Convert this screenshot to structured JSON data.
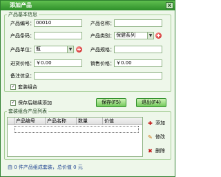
{
  "window": {
    "title": "添加产品",
    "close_label": "x"
  },
  "product_info": {
    "group_title": "产品基本信息",
    "code_label": "产品编号：",
    "code_value": "00010",
    "name_label": "产品名称：",
    "name_value": "",
    "barcode_label": "产品条码：",
    "barcode_value": "",
    "category_label": "产品类别：",
    "category_value": "保健系列",
    "unit_label": "产品单位：",
    "unit_value": "瓶",
    "spec_label": "产品规格：",
    "spec_value": "",
    "purchase_price_label": "进货价格：",
    "purchase_price_value": "￥0.00",
    "sale_price_label": "销售价格：",
    "sale_price_value": "￥0.00",
    "remark_label": "备注信息：",
    "remark_value": "",
    "package_combo_label": "套装组合",
    "package_combo_checked": true
  },
  "continue_after_save": {
    "label": "保存后继续添加",
    "checked": true
  },
  "buttons": {
    "save_label": "保存(F5)",
    "exit_label": "退出(F4)"
  },
  "package_list": {
    "group_title": "套装组合产品列表",
    "columns": [
      "产品编号",
      "产品名称",
      "数量",
      "价值"
    ],
    "rows": []
  },
  "actions": {
    "add_label": "添加",
    "edit_label": "修改",
    "delete_label": "删除"
  },
  "status": {
    "text": "由 0 件产品组成套装，总价值 0 元"
  },
  "colors": {
    "title_bar": "#2e8f2a",
    "accent": "#73c95c",
    "add_icon": "#c21818"
  }
}
